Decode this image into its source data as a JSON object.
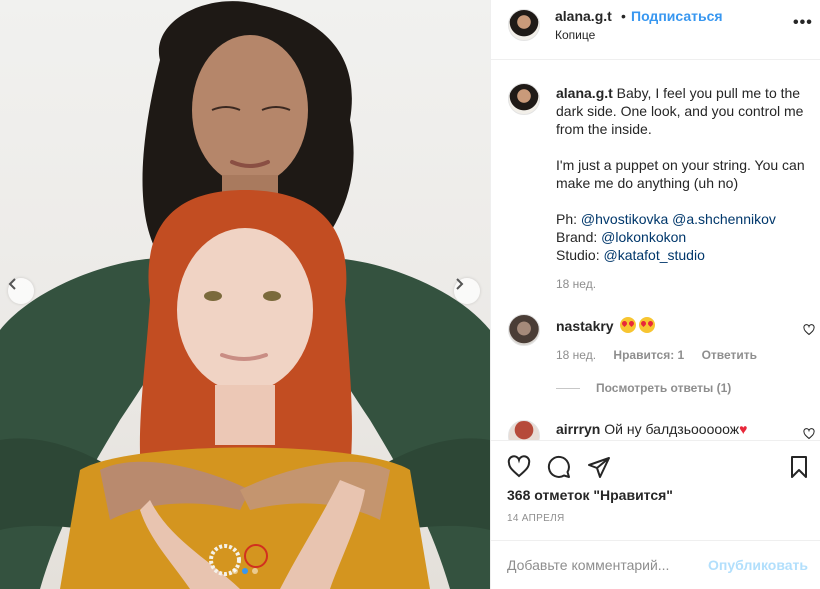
{
  "post": {
    "username": "alana.g.t",
    "separator": "•",
    "follow_label": "Подписаться",
    "location": "Копице",
    "more_label": "•••"
  },
  "caption": {
    "username": "alana.g.t",
    "text_1": " Baby, I feel you pull me to the dark side. One look, and you control me from the inside.\n\nI'm just a puppet on your string. You can make me do anything (uh no)\n\nPh: ",
    "mention_1": "@hvostikovka",
    "mention_2": "@a.shchennikov",
    "brand_label": "\nBrand: ",
    "mention_3": "@lokonkokon",
    "studio_label": "\nStudio: ",
    "mention_4": "@katafot_studio",
    "age": "18 нед."
  },
  "comments": [
    {
      "username": "nastakry",
      "age": "18 нед.",
      "likes": "Нравится: 1",
      "reply": "Ответить",
      "view_replies": "Посмотреть ответы (1)"
    },
    {
      "username": "airrryn",
      "text": " Ой ну балдзьооооож",
      "heart": "♥"
    }
  ],
  "actions": {
    "likes_count": "368 отметок \"Нравится\"",
    "date": "14 АПРЕЛЯ"
  },
  "composer": {
    "placeholder": "Добавьте комментарий...",
    "post_label": "Опубликовать"
  },
  "carousel": {
    "total": 3,
    "active": 2
  },
  "colors": {
    "accent": "#3897f0",
    "text": "#262626",
    "muted": "#8e8e8e",
    "link": "#00376b",
    "post_disabled": "#b2dffc"
  }
}
